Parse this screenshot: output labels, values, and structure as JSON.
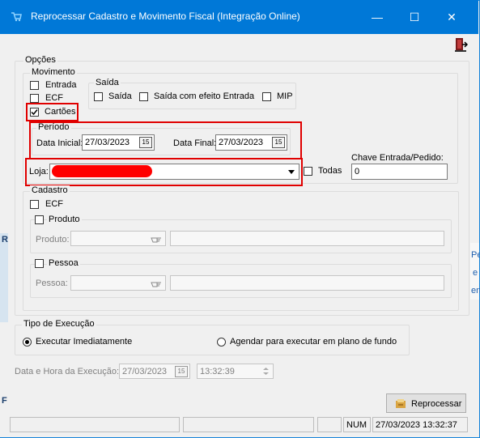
{
  "window": {
    "title": "Reprocessar Cadastro e Movimento Fiscal (Integração Online)",
    "minimize_glyph": "—",
    "maximize_glyph": "☐",
    "close_glyph": "✕"
  },
  "opcoes": {
    "label": "Opções",
    "movimento": {
      "label": "Movimento",
      "entrada": {
        "label": "Entrada",
        "checked": false
      },
      "ecf": {
        "label": "ECF",
        "checked": false
      },
      "cartoes": {
        "label": "Cartões",
        "checked": true
      }
    },
    "saida": {
      "label": "Saída",
      "saida": {
        "label": "Saída",
        "checked": false
      },
      "saida_efeito_entrada": {
        "label": "Saída com efeito Entrada",
        "checked": false
      },
      "mip": {
        "label": "MIP",
        "checked": false
      }
    },
    "periodo": {
      "label": "Período",
      "data_inicial_label": "Data Inicial:",
      "data_inicial": "27/03/2023",
      "data_final_label": "Data Final:",
      "data_final": "27/03/2023",
      "calendar_glyph": "15"
    },
    "loja": {
      "label": "Loja:",
      "todas_label": "Todas",
      "todas_checked": false
    },
    "chave": {
      "label": "Chave Entrada/Pedido:",
      "value": "0"
    },
    "cadastro": {
      "label": "Cadastro",
      "ecf": {
        "label": "ECF",
        "checked": false
      },
      "produto": {
        "label": "Produto",
        "checked": false,
        "field_label": "Produto:"
      },
      "pessoa": {
        "label": "Pessoa",
        "checked": false,
        "field_label": "Pessoa:"
      }
    }
  },
  "execucao": {
    "label": "Tipo de Execução",
    "imediato": {
      "label": "Executar Imediatamente",
      "selected": true
    },
    "agendar": {
      "label": "Agendar para executar em plano de fundo",
      "selected": false
    },
    "data_hora_label": "Data e Hora da Execução:",
    "data": "27/03/2023",
    "hora": "13:32:39"
  },
  "buttons": {
    "reprocessar": "Reprocessar"
  },
  "statusbar": {
    "num": "NUM",
    "datetime": "27/03/2023 13:32:37"
  },
  "background_fragments": {
    "left_r": "R",
    "left_f": "F",
    "right_pe": "Pe",
    "right_e": "e",
    "right_en": "en"
  },
  "colors": {
    "titlebar": "#0078d7",
    "highlight_red": "#e00000",
    "window_bg": "#f0f0f0"
  }
}
